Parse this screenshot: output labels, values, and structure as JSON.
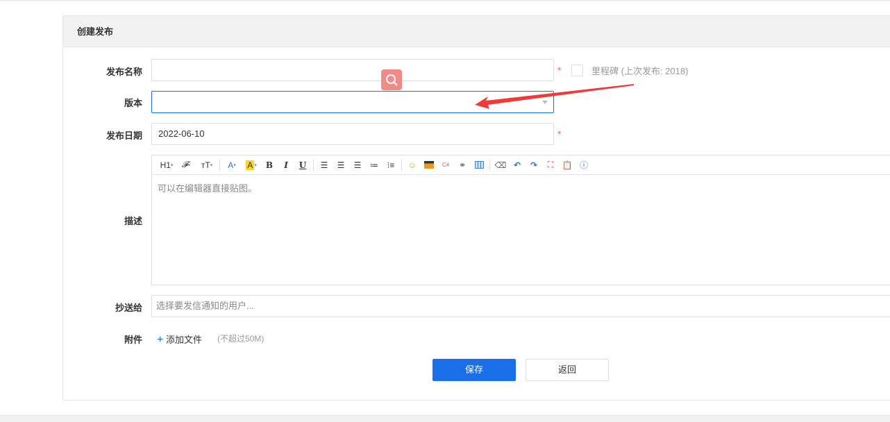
{
  "panel": {
    "title": "创建发布"
  },
  "form": {
    "name_label": "发布名称",
    "name_value": "",
    "required_mark": "*",
    "milestone_label": "里程碑 (上次发布: 2018)",
    "version_label": "版本",
    "version_value": "",
    "date_label": "发布日期",
    "date_value": "2022-06-10",
    "desc_label": "描述",
    "desc_placeholder": "可以在编辑器直接贴图。",
    "cc_label": "抄送给",
    "cc_placeholder": "选择要发信通知的用户...",
    "attach_label": "附件",
    "attach_button": "添加文件",
    "attach_hint": "(不超过50M)"
  },
  "toolbar": {
    "h1": "H1",
    "font": "𝓕",
    "size": "ᴛT",
    "color": "A",
    "bg": "A",
    "bold": "B",
    "italic": "I",
    "underline": "U"
  },
  "actions": {
    "save": "保存",
    "back": "返回"
  },
  "colors": {
    "accent": "#1a6fe8",
    "required": "#f56c6c",
    "arrow": "#f03a3a"
  }
}
